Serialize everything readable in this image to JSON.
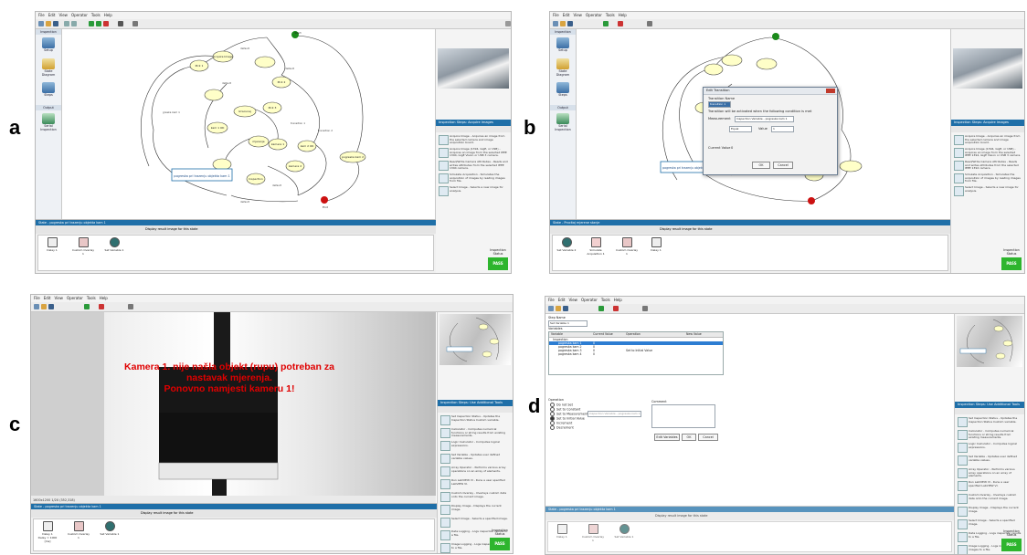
{
  "panel_letters": [
    "a",
    "b",
    "c",
    "d"
  ],
  "menu": [
    "File",
    "Edit",
    "View",
    "Operator",
    "Tools",
    "Help"
  ],
  "sidebar": {
    "header_inspection": "Inspection",
    "setup": "Setup",
    "state_diagram": "State Diagram",
    "steps": "Steps",
    "header_output": "Output",
    "serial_inspection": "Serial Inspection"
  },
  "right_panel": {
    "title_a": "Inspection Steps: Acquire Images",
    "title_c": "Inspection Steps: Use Additional Tools",
    "acquire_items": [
      "Acquire Image - Acquires an image from the selected camera and image acquisition board.",
      "Acquire Image (1394, GigE, or USB) - Acquires an image from the selected IEEE 1394, GigE Vision or USB 3 camera.",
      "Read/Write Camera Attributes - Reads and writes attributes from the selected IEEE 1394 camera.",
      "Simulate Acquisition - Simulates the acquisition of images by reading images from file.",
      "Select Image - Selects a new image for analysis."
    ],
    "tools_items": [
      "Set Inspection Status - Updates the Inspection Status Custom variable.",
      "Calculator - Computes numerical functions or string results from existing measurements.",
      "Logic Calculator - Computes logical expressions.",
      "Set Variable - Updates user defined variable values.",
      "Array Operator - Performs various array operations on an array of elements.",
      "Run LabVIEW VI - Runs a user specified LabVIEW VI.",
      "Custom Overlay - Overlays custom data onto the current image.",
      "Display Image - Displays the current image.",
      "Select Image - Selects a specified image.",
      "Data Logging - Logs inspection results to a file.",
      "Image Logging - Logs inspection images to a file."
    ]
  },
  "bottom": {
    "state_a": "State - pogreska pri trazenju objekta kam 1",
    "state_b": "State - Procitaj mjerene stanje",
    "state_c": "State - pogreska pri trazenju objekta kam 1",
    "state_d": "State - pogreska pri trazenju objekta kam 1",
    "display_checkbox": "Display result image for this state",
    "steps_a": [
      "Delay 1",
      "Custom Overlay 1",
      "Set Variable 1"
    ],
    "steps_b": [
      "Set Variable 2",
      "Simulate Acquisition 1",
      "Custom Overlay 1",
      "Delay 1"
    ],
    "steps_c": [
      "Delay 1",
      "Custom Overlay 1",
      "Set Variable 1"
    ],
    "steps_c_extra": "Delay = 1000 [ms]",
    "steps_d": [
      "Delay 1",
      "Custom Overlay 1",
      "Set Variable 1"
    ],
    "inspection_status": "Inspection Status",
    "pass_label": "PASS"
  },
  "diagram_nodes": [
    "Start",
    "Acquire Image",
    "Pick 1",
    "Pick 2",
    "Pick 3",
    "Izracunaj",
    "kam 1 OK",
    "kam 2 OK",
    "mjerenje",
    "kamera 1",
    "kamera 2",
    "Inspection",
    "pogreska kam 2",
    "End"
  ],
  "diagram_box_label": "pogreska pri trazenju objekta kam 1",
  "edge_labels": [
    "default",
    "default",
    "default",
    "greska kam 1",
    "transition 1",
    "transition 2",
    "default",
    "default"
  ],
  "dialog": {
    "title": "Edit Transition",
    "name_label": "Transition Name",
    "name_value": "transition 1",
    "instruction": "Transition will be activated when the following condition is met",
    "measurement_label": "Measurement",
    "measurement_value": "Inspection Variable - pogreska kam 1",
    "operator_label": "Equal",
    "value_label": "Value",
    "value_value": "1",
    "current_value_label": "Current Value",
    "current_value": "0",
    "ok": "OK",
    "cancel": "Cancel"
  },
  "camera_message": {
    "line1": "Kamera 1. nije našla objekt (rupu) potreban za",
    "line2": "nastavak mjerenja.",
    "line3": "Ponovno namjesti kameru 1!"
  },
  "camera_status": "1600x1200 1/2X  (352,318)",
  "setvar": {
    "step_name_label": "Step Name",
    "step_name_value": "Set Variable 1",
    "variables_label": "Variables",
    "columns": [
      "Variable",
      "Current Value",
      "Operation",
      "New Value"
    ],
    "rows": [
      {
        "name": "Inspection",
        "current": "",
        "op": "",
        "new": ""
      },
      {
        "name": "pogreska kam 1",
        "current": "0",
        "op": "",
        "new": "",
        "selected": true
      },
      {
        "name": "pogreska kam 2",
        "current": "0",
        "op": "",
        "new": ""
      },
      {
        "name": "pogreska kam 3",
        "current": "0",
        "op": "Set to Initial Value",
        "new": ""
      },
      {
        "name": "pogreska kam 4",
        "current": "0",
        "op": "",
        "new": ""
      }
    ],
    "operation_label": "Operation",
    "operations": [
      "Do not Set",
      "Set to Constant",
      "Set to Measurement",
      "Set to Initial Value",
      "Increment",
      "Decrement"
    ],
    "measurement_placeholder": "Inspection Variable - pogreska kam 1",
    "comment_label": "Comment",
    "edit_variables": "Edit Variables",
    "ok": "OK",
    "cancel": "Cancel"
  },
  "colors": {
    "title_bar": "#1f6fa8",
    "node_fill": "#ffffc8",
    "pass": "#2db52d",
    "message_red": "#e00000",
    "start_node": "#1a8a1a",
    "end_node": "#cc1111"
  }
}
